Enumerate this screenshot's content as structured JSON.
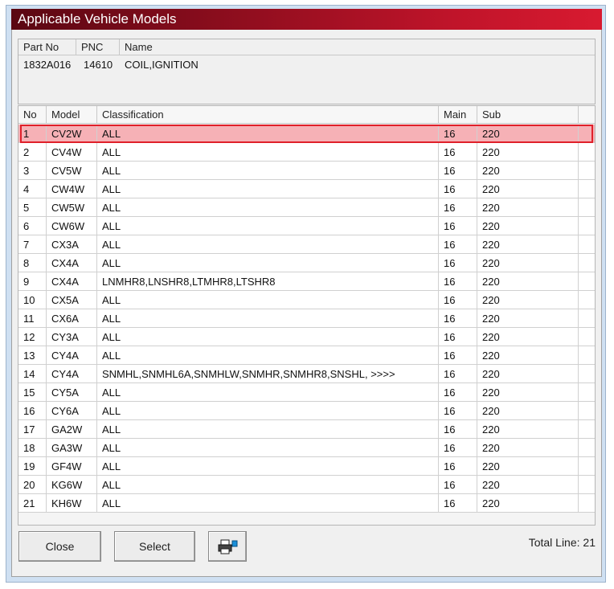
{
  "window": {
    "title": "Applicable Vehicle Models"
  },
  "part": {
    "headers": {
      "part_no": "Part No",
      "pnc": "PNC",
      "name": "Name"
    },
    "values": {
      "part_no": "1832A016",
      "pnc": "14610",
      "name": "COIL,IGNITION"
    }
  },
  "grid": {
    "headers": {
      "no": "No",
      "model": "Model",
      "classification": "Classification",
      "main": "Main",
      "sub": "Sub"
    },
    "rows": [
      {
        "no": "1",
        "model": "CV2W",
        "classification": "ALL",
        "main": "16",
        "sub": "220"
      },
      {
        "no": "2",
        "model": "CV4W",
        "classification": "ALL",
        "main": "16",
        "sub": "220"
      },
      {
        "no": "3",
        "model": "CV5W",
        "classification": "ALL",
        "main": "16",
        "sub": "220"
      },
      {
        "no": "4",
        "model": "CW4W",
        "classification": "ALL",
        "main": "16",
        "sub": "220"
      },
      {
        "no": "5",
        "model": "CW5W",
        "classification": "ALL",
        "main": "16",
        "sub": "220"
      },
      {
        "no": "6",
        "model": "CW6W",
        "classification": "ALL",
        "main": "16",
        "sub": "220"
      },
      {
        "no": "7",
        "model": "CX3A",
        "classification": "ALL",
        "main": "16",
        "sub": "220"
      },
      {
        "no": "8",
        "model": "CX4A",
        "classification": "ALL",
        "main": "16",
        "sub": "220"
      },
      {
        "no": "9",
        "model": "CX4A",
        "classification": "LNMHR8,LNSHR8,LTMHR8,LTSHR8",
        "main": "16",
        "sub": "220"
      },
      {
        "no": "10",
        "model": "CX5A",
        "classification": "ALL",
        "main": "16",
        "sub": "220"
      },
      {
        "no": "11",
        "model": "CX6A",
        "classification": "ALL",
        "main": "16",
        "sub": "220"
      },
      {
        "no": "12",
        "model": "CY3A",
        "classification": "ALL",
        "main": "16",
        "sub": "220"
      },
      {
        "no": "13",
        "model": "CY4A",
        "classification": "ALL",
        "main": "16",
        "sub": "220"
      },
      {
        "no": "14",
        "model": "CY4A",
        "classification": "SNMHL,SNMHL6A,SNMHLW,SNMHR,SNMHR8,SNSHL,  >>>>",
        "main": "16",
        "sub": "220"
      },
      {
        "no": "15",
        "model": "CY5A",
        "classification": "ALL",
        "main": "16",
        "sub": "220"
      },
      {
        "no": "16",
        "model": "CY6A",
        "classification": "ALL",
        "main": "16",
        "sub": "220"
      },
      {
        "no": "17",
        "model": "GA2W",
        "classification": "ALL",
        "main": "16",
        "sub": "220"
      },
      {
        "no": "18",
        "model": "GA3W",
        "classification": "ALL",
        "main": "16",
        "sub": "220"
      },
      {
        "no": "19",
        "model": "GF4W",
        "classification": "ALL",
        "main": "16",
        "sub": "220"
      },
      {
        "no": "20",
        "model": "KG6W",
        "classification": "ALL",
        "main": "16",
        "sub": "220"
      },
      {
        "no": "21",
        "model": "KH6W",
        "classification": "ALL",
        "main": "16",
        "sub": "220"
      }
    ],
    "selected_row": "1"
  },
  "buttons": {
    "close": "Close",
    "select": "Select",
    "print_icon": "printer-icon"
  },
  "footer": {
    "total": "Total Line: 21"
  },
  "colors": {
    "title_start": "#5a0712",
    "title_end": "#d81a30",
    "selected_fill": "#f6b1b6",
    "selected_border": "#e0202a"
  }
}
